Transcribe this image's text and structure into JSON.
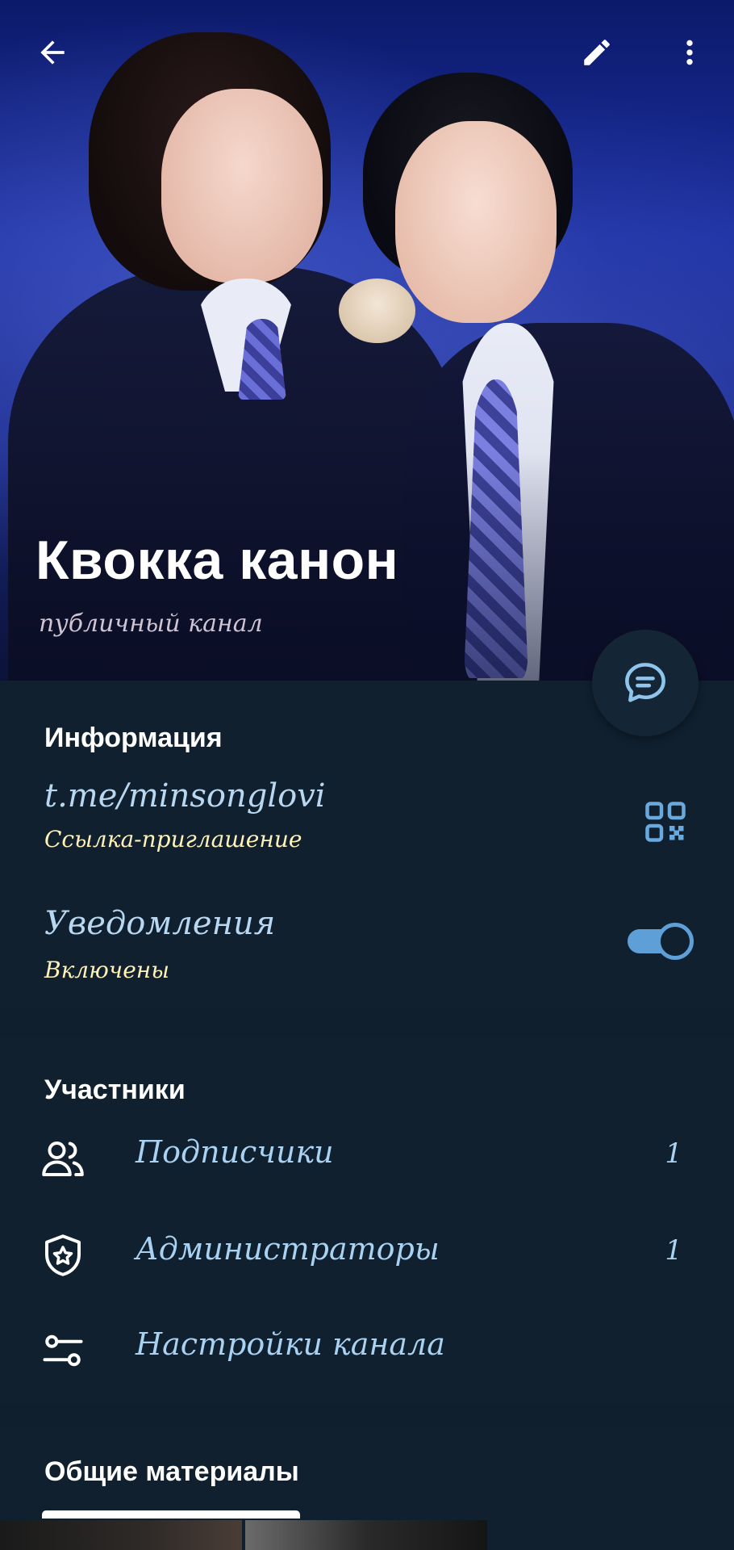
{
  "header": {
    "title": "Квокка канон",
    "subtitle": "публичный канал",
    "icons": {
      "back": "arrow-left-icon",
      "edit": "pencil-icon",
      "more": "more-vertical-icon",
      "chat": "chat-bubble-icon"
    }
  },
  "info": {
    "title": "Информация",
    "link": {
      "value": "t.me/minsonglovi",
      "label": "Ссылка-приглашение",
      "icon": "qr-code-icon"
    },
    "notifications": {
      "label": "Уведомления",
      "status": "Включены",
      "enabled": true
    }
  },
  "members": {
    "title": "Участники",
    "items": [
      {
        "label": "Подписчики",
        "count": "1",
        "icon": "users-icon"
      },
      {
        "label": "Администраторы",
        "count": "1",
        "icon": "shield-star-icon"
      },
      {
        "label": "Настройки канала",
        "count": "",
        "icon": "sliders-icon"
      }
    ]
  },
  "shared": {
    "title": "Общие материалы"
  },
  "colors": {
    "background": "#10202f",
    "accent": "#5f9fd8",
    "label_blue": "#a9d2f2",
    "secondary_yellow": "#fff2b8"
  }
}
